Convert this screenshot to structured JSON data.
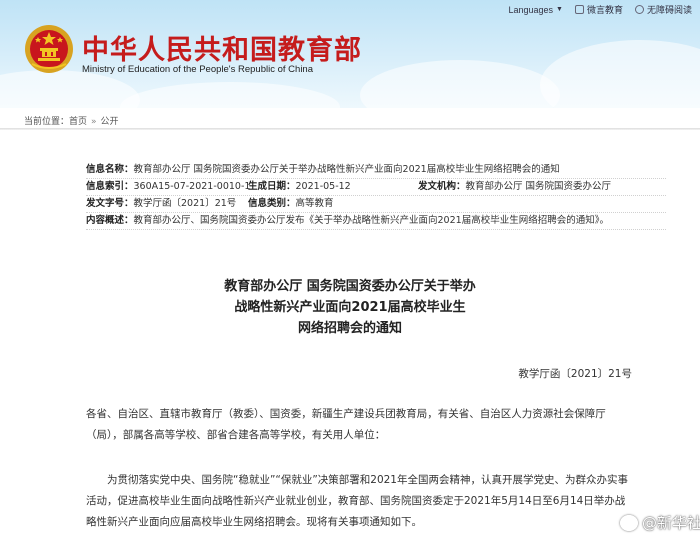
{
  "header": {
    "title_cn": "中华人民共和国教育部",
    "title_en": "Ministry of Education of the People's Republic of China",
    "links": [
      {
        "label": "Languages",
        "icon": "chevron-down-icon"
      },
      {
        "label": "微言教育",
        "icon": "wechat-icon"
      },
      {
        "label": "无障碍阅读",
        "icon": "accessibility-icon"
      }
    ]
  },
  "breadcrumb": {
    "prefix": "当前位置：",
    "items": [
      "首页",
      "公开"
    ],
    "separator": "»"
  },
  "info": {
    "rows": [
      {
        "label": "信息名称：",
        "value": "教育部办公厅 国务院国资委办公厅关于举办战略性新兴产业面向2021届高校毕业生网络招聘会的通知"
      },
      {
        "label": "信息索引：",
        "value": "360A15-07-2021-0010-1",
        "label2": "生成日期：",
        "value2": "2021-05-12",
        "label3": "发文机构：",
        "value3": "教育部办公厅  国务院国资委办公厅"
      },
      {
        "label": "发文字号：",
        "value": "教学厅函〔2021〕21号",
        "label2": "信息类别：",
        "value2": "高等教育"
      },
      {
        "label": "内容概述：",
        "value": "教育部办公厅、国务院国资委办公厅发布《关于举办战略性新兴产业面向2021届高校毕业生网络招聘会的通知》。"
      }
    ]
  },
  "document": {
    "title_lines": [
      "教育部办公厅 国务院国资委办公厅关于举办",
      "战略性新兴产业面向2021届高校毕业生",
      "网络招聘会的通知"
    ],
    "doc_number": "教学厅函〔2021〕21号",
    "paragraphs": [
      "各省、自治区、直辖市教育厅（教委）、国资委，新疆生产建设兵团教育局，有关省、自治区人力资源社会保障厅（局），部属各高等学校、部省合建各高等学校，有关用人单位：",
      "为贯彻落实党中央、国务院“稳就业”“保就业”决策部署和2021年全国两会精神，认真开展学党史、为群众办实事活动，促进高校毕业生面向战略性新兴产业就业创业，教育部、国务院国资委定于2021年5月14日至6月14日举办战略性新兴产业面向应届高校毕业生网络招聘会。现将有关事项通知如下。"
    ]
  },
  "watermark": {
    "text": "@新华社",
    "icon": "weibo-icon"
  },
  "colors": {
    "title_red": "#c51c1c",
    "header_blue": "#bfe3f6"
  }
}
